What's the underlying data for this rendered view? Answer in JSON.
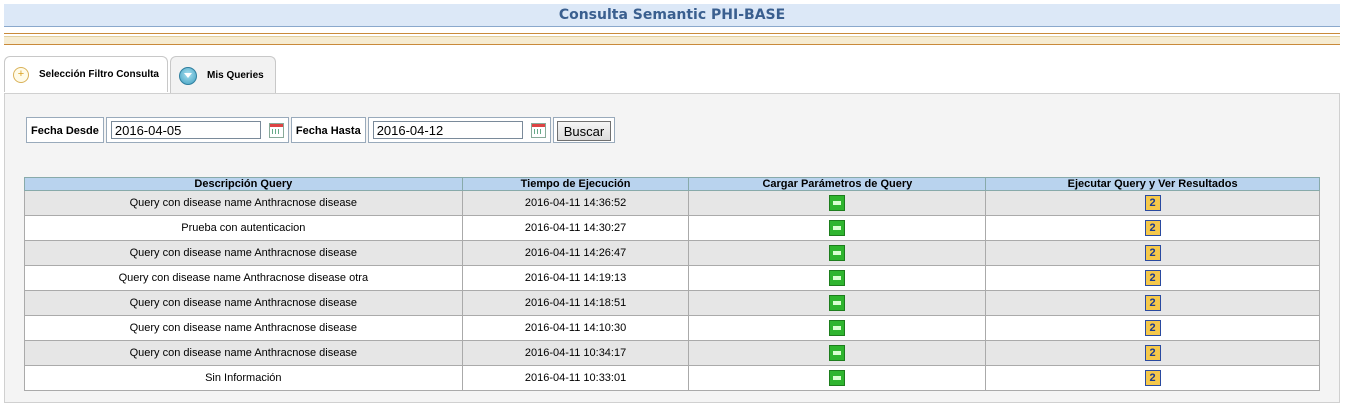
{
  "header": {
    "title": "Consulta Semantic PHI-BASE"
  },
  "tabs": [
    {
      "label": "Selección Filtro Consulta"
    },
    {
      "label": "Mis Queries"
    }
  ],
  "filter": {
    "fecha_desde_label": "Fecha Desde",
    "fecha_desde_value": "2016-04-05",
    "fecha_hasta_label": "Fecha Hasta",
    "fecha_hasta_value": "2016-04-12",
    "buscar_label": "Buscar"
  },
  "table": {
    "columns": [
      "Descripción Query",
      "Tiempo de Ejecución",
      "Cargar Parámetros de Query",
      "Ejecutar Query y Ver Resultados"
    ],
    "rows": [
      {
        "desc": "Query con disease name Anthracnose disease",
        "time": "2016-04-11 14:36:52"
      },
      {
        "desc": "Prueba con autenticacion",
        "time": "2016-04-11 14:30:27"
      },
      {
        "desc": "Query con disease name Anthracnose disease",
        "time": "2016-04-11 14:26:47"
      },
      {
        "desc": "Query con disease name Anthracnose disease otra",
        "time": "2016-04-11 14:19:13"
      },
      {
        "desc": "Query con disease name Anthracnose disease",
        "time": "2016-04-11 14:18:51"
      },
      {
        "desc": "Query con disease name Anthracnose disease",
        "time": "2016-04-11 14:10:30"
      },
      {
        "desc": "Query con disease name Anthracnose disease",
        "time": "2016-04-11 10:34:17"
      },
      {
        "desc": "Sin Información",
        "time": "2016-04-11 10:33:01"
      }
    ],
    "load_icon": "load-params-icon",
    "exec_icon": "execute-query-icon",
    "exec_icon_glyph": "2"
  }
}
